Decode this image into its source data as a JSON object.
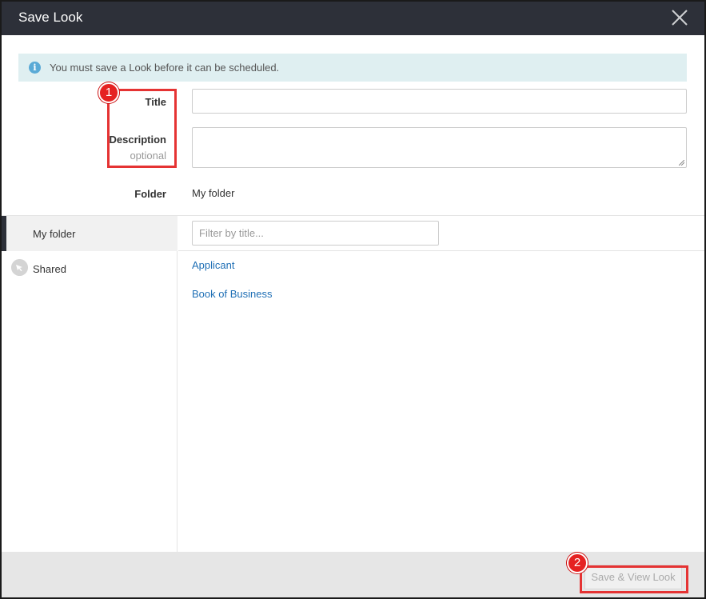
{
  "dialog": {
    "title": "Save Look",
    "alert_message": "You must save a Look before it can be scheduled."
  },
  "form": {
    "title_label": "Title",
    "title_value": "",
    "description_label": "Description",
    "description_hint": "optional",
    "description_value": "",
    "folder_label": "Folder",
    "folder_value": "My folder"
  },
  "folders": {
    "items": [
      {
        "label": "My folder",
        "active": true
      },
      {
        "label": "Shared",
        "active": false
      }
    ],
    "filter_placeholder": "Filter by title...",
    "looks": [
      "Applicant",
      "Book of Business"
    ]
  },
  "footer": {
    "save_label": "Save & View Look"
  },
  "annotations": [
    "1",
    "2"
  ],
  "colors": {
    "titlebar": "#2d3039",
    "link": "#1f6fb5",
    "callout": "#e53333",
    "alert_bg": "#dfeff1"
  }
}
